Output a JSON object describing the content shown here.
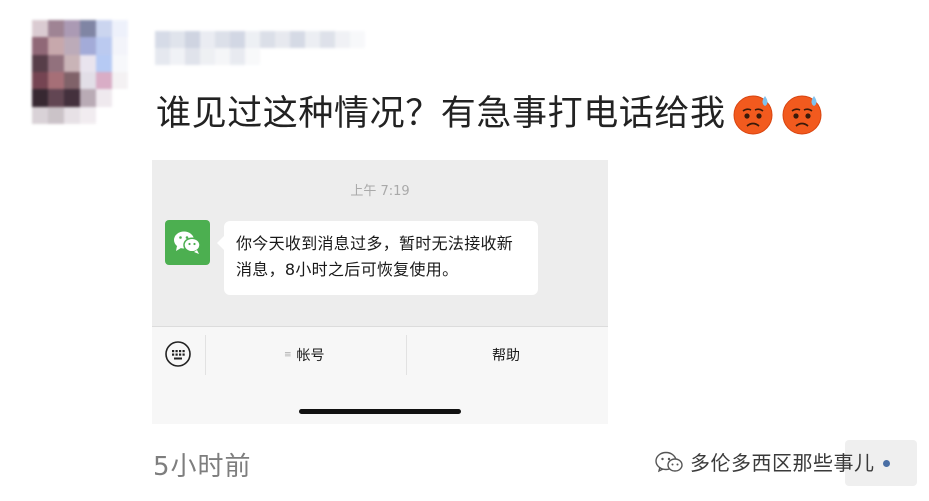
{
  "post": {
    "text": "谁见过这种情况？有急事打电话给我",
    "emojis": [
      "cold-sweat-face",
      "cold-sweat-face"
    ],
    "time_ago": "5小时前"
  },
  "screenshot": {
    "time": "上午 7:19",
    "message": "你今天收到消息过多，暂时无法接收新消息，8小时之后可恢复使用。",
    "menu": {
      "account_label": "帐号",
      "help_label": "帮助"
    }
  },
  "watermark": {
    "text": "多伦多西区那些事儿"
  },
  "colors": {
    "wechat_green": "#4caf50",
    "chat_background": "#ededed",
    "text_gray": "#7e7e7e"
  }
}
